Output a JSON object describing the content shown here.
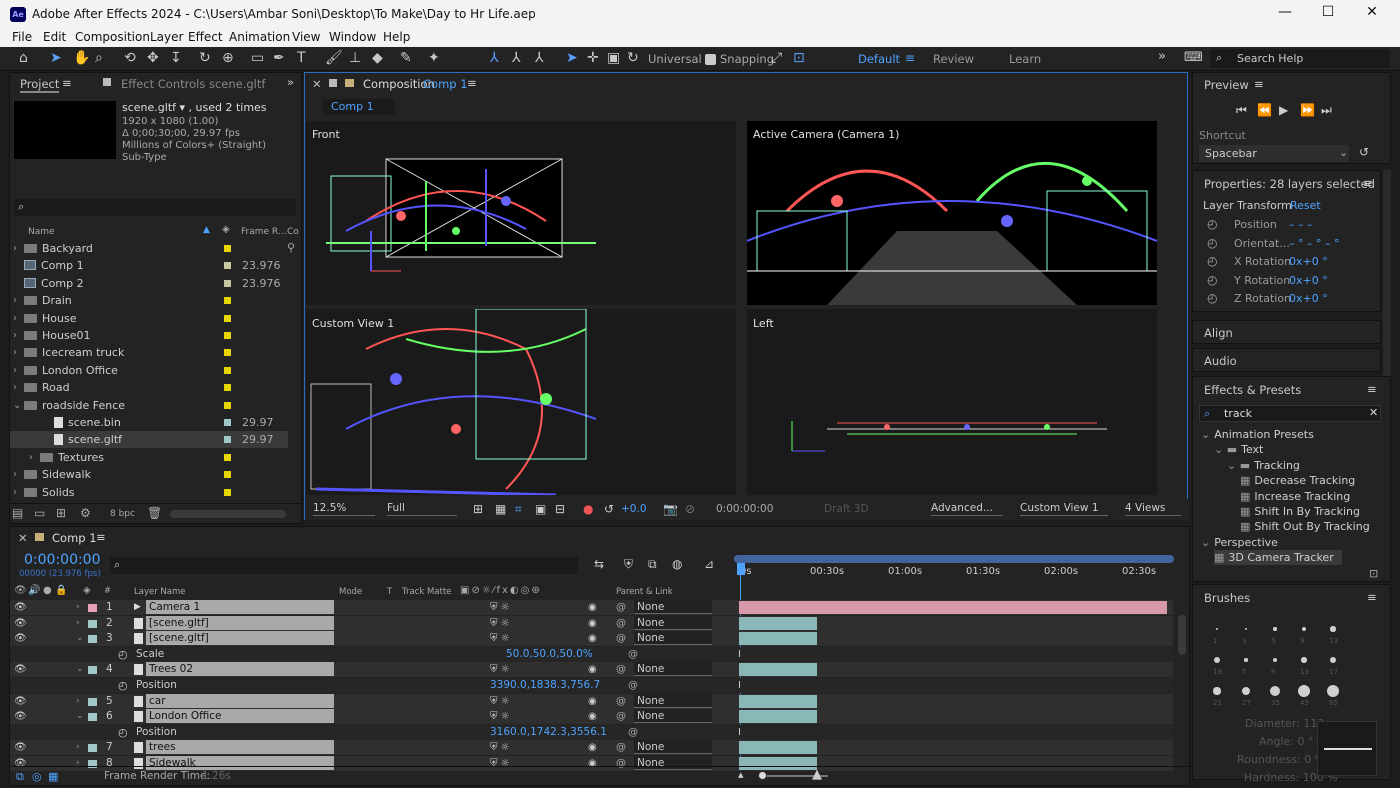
{
  "window": {
    "title": "Adobe After Effects 2024 - C:\\Users\\Ambar Soni\\Desktop\\To Make\\Day to Hr Life.aep",
    "logo": "Ae",
    "min": "—",
    "max": "☐",
    "close": "✕"
  },
  "menu": [
    "File",
    "Edit",
    "Composition",
    "Layer",
    "Effect",
    "Animation",
    "View",
    "Window",
    "Help"
  ],
  "toolbar": {
    "universal": "Universal",
    "snapping": "Snapping",
    "workspaces": [
      "Default",
      "Review",
      "Learn"
    ],
    "search": "Search Help"
  },
  "project": {
    "tab": "Project",
    "effect_tab": "Effect Controls scene.gltf",
    "item_name": "scene.gltf ▾ , used 2 times",
    "info": [
      "1920 x 1080 (1.00)",
      "Δ 0;00;30;00, 29.97 fps",
      "Millions of Colors+ (Straight)",
      "Sub-Type"
    ],
    "col_name": "Name",
    "col_fr": "Frame R...",
    "col_c": "Co",
    "bpc": "8 bpc",
    "items": [
      {
        "name": "Backyard",
        "type": "folder",
        "color": "#e8d600",
        "fr": ""
      },
      {
        "name": "Comp 1",
        "type": "comp",
        "color": "#c8c8a0",
        "fr": "23.976"
      },
      {
        "name": "Comp 2",
        "type": "comp",
        "color": "#c8c8a0",
        "fr": "23.976"
      },
      {
        "name": "Drain",
        "type": "folder",
        "color": "#e8d600",
        "fr": ""
      },
      {
        "name": "House",
        "type": "folder",
        "color": "#e8d600",
        "fr": ""
      },
      {
        "name": "House01",
        "type": "folder",
        "color": "#e8d600",
        "fr": ""
      },
      {
        "name": "Icecream truck",
        "type": "folder",
        "color": "#e8d600",
        "fr": ""
      },
      {
        "name": "London Office",
        "type": "folder",
        "color": "#e8d600",
        "fr": ""
      },
      {
        "name": "Road",
        "type": "folder",
        "color": "#e8d600",
        "fr": ""
      },
      {
        "name": "roadside Fence",
        "type": "folder",
        "color": "#e8d600",
        "fr": ""
      },
      {
        "name": "scene.bin",
        "type": "file",
        "color": "#a0c8c8",
        "fr": "29.97"
      },
      {
        "name": "scene.gltf",
        "type": "file",
        "color": "#a0c8c8",
        "fr": "29.97"
      },
      {
        "name": "Textures",
        "type": "folder",
        "color": "#e8d600",
        "fr": ""
      },
      {
        "name": "Sidewalk",
        "type": "folder",
        "color": "#e8d600",
        "fr": ""
      },
      {
        "name": "Solids",
        "type": "folder",
        "color": "#e8d600",
        "fr": ""
      }
    ]
  },
  "composition": {
    "tab": "Composition",
    "comp_name": "Comp 1",
    "crumb": "Comp 1",
    "views": {
      "front": "Front",
      "active": "Active Camera (Camera 1)",
      "custom": "Custom View 1",
      "left": "Left"
    },
    "footer": {
      "zoom": "12.5%",
      "res": "Full",
      "exposure": "+0.0",
      "time": "0:00:00:00",
      "draft": "Draft 3D",
      "renderer": "Advanced...",
      "view": "Custom View 1",
      "layout": "4 Views"
    }
  },
  "preview": {
    "title": "Preview",
    "shortcut_label": "Shortcut",
    "shortcut": "Spacebar"
  },
  "properties": {
    "title": "Properties: 28 layers selected",
    "transform": "Layer Transform",
    "reset": "Reset",
    "rows": [
      {
        "label": "Position",
        "value": "–  –  –"
      },
      {
        "label": "Orientat...",
        "value": "– °  – °  – °"
      },
      {
        "label": "X Rotation",
        "value": "0x+0 °"
      },
      {
        "label": "Y Rotation",
        "value": "0x+0 °"
      },
      {
        "label": "Z Rotation",
        "value": "0x+0 °"
      }
    ]
  },
  "side": {
    "align": "Align",
    "audio": "Audio",
    "effects": "Effects & Presets",
    "search": "track",
    "tree": [
      {
        "label": "Animation Presets",
        "indent": 0
      },
      {
        "label": "Text",
        "indent": 1
      },
      {
        "label": "Tracking",
        "indent": 2
      },
      {
        "label": "Decrease Tracking",
        "indent": 3
      },
      {
        "label": "Increase Tracking",
        "indent": 3
      },
      {
        "label": "Shift In By Tracking",
        "indent": 3
      },
      {
        "label": "Shift Out By Tracking",
        "indent": 3
      },
      {
        "label": "Perspective",
        "indent": 0
      },
      {
        "label": "3D Camera Tracker",
        "indent": 1
      }
    ],
    "brushes": "Brushes",
    "diameter": "Diameter: 113 px",
    "angle": "Angle: 0 °",
    "roundness": "Roundness: 0 %",
    "hardness": "Hardness: 100 %",
    "brush_sizes": [
      "1",
      "3",
      "5",
      "9",
      "13",
      "19",
      "5",
      "9",
      "13",
      "17",
      "21",
      "27",
      "35",
      "45",
      "65"
    ]
  },
  "timeline": {
    "tab": "Comp 1",
    "timecode": "0:00:00:00",
    "fps": "00000 (23.976 fps)",
    "col_layer": "Layer Name",
    "col_mode": "Mode",
    "col_t": "T",
    "col_matte": "Track Matte",
    "col_parent": "Parent & Link",
    "col_hash": "#",
    "ruler": [
      "0s",
      "00:30s",
      "01:00s",
      "01:30s",
      "02:00s",
      "02:30s"
    ],
    "layers": [
      {
        "num": "1",
        "name": "Camera 1",
        "color": "#e8a0b8",
        "parent": "None",
        "kind": "layer",
        "bar": "#d89aaa",
        "barw": 428
      },
      {
        "num": "2",
        "name": "[scene.gltf]",
        "color": "#a0c8c8",
        "parent": "None",
        "kind": "layer",
        "bar": "#8ab8b8",
        "barw": 78
      },
      {
        "num": "3",
        "name": "[scene.gltf]",
        "color": "#a0c8c8",
        "parent": "None",
        "kind": "layer",
        "bar": "#8ab8b8",
        "barw": 78
      },
      {
        "num": "",
        "name": "Scale",
        "value": "50.0,50.0,50.0%",
        "kind": "prop"
      },
      {
        "num": "4",
        "name": "Trees 02",
        "color": "#a0c8c8",
        "parent": "None",
        "kind": "layer",
        "bar": "#8ab8b8",
        "barw": 78
      },
      {
        "num": "",
        "name": "Position",
        "value": "3390.0,1838.3,756.7",
        "kind": "prop"
      },
      {
        "num": "5",
        "name": "car",
        "color": "#a0c8c8",
        "parent": "None",
        "kind": "layer",
        "bar": "#8ab8b8",
        "barw": 78
      },
      {
        "num": "6",
        "name": "London Office",
        "color": "#a0c8c8",
        "parent": "None",
        "kind": "layer",
        "bar": "#8ab8b8",
        "barw": 78
      },
      {
        "num": "",
        "name": "Position",
        "value": "3160.0,1742.3,3556.1",
        "kind": "prop"
      },
      {
        "num": "7",
        "name": "trees",
        "color": "#a0c8c8",
        "parent": "None",
        "kind": "layer",
        "bar": "#8ab8b8",
        "barw": 78
      },
      {
        "num": "8",
        "name": "Sidewalk",
        "color": "#a0c8c8",
        "parent": "None",
        "kind": "layer",
        "bar": "#8ab8b8",
        "barw": 78
      }
    ],
    "render_time_label": "Frame Render Time:",
    "render_time": "1.26s"
  }
}
